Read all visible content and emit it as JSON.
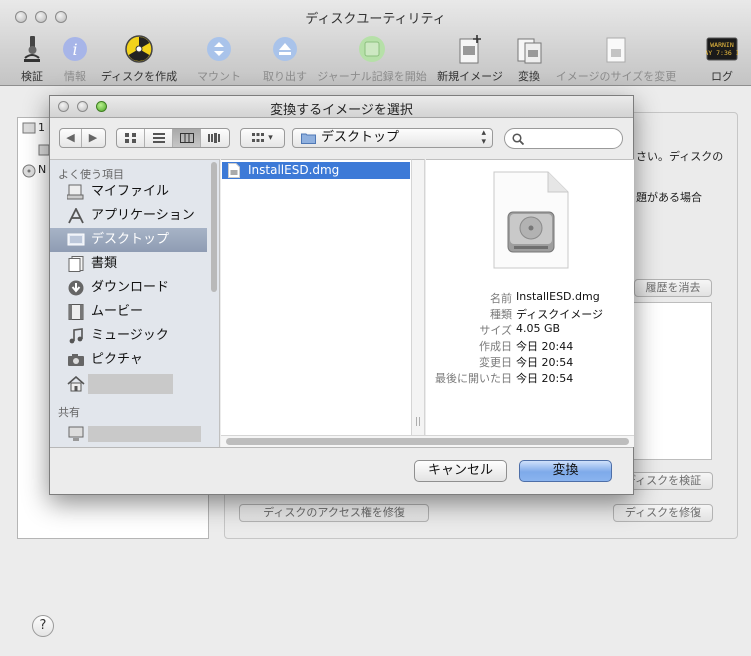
{
  "main": {
    "title": "ディスクユーティリティ",
    "toolbar": [
      {
        "label": "検証",
        "icon": "microscope-icon",
        "enabled": true
      },
      {
        "label": "情報",
        "icon": "info-icon",
        "enabled": false
      },
      {
        "label": "ディスクを作成",
        "icon": "burn-icon",
        "enabled": true
      },
      {
        "label": "マウント",
        "icon": "mount-icon",
        "enabled": false
      },
      {
        "label": "取り出す",
        "icon": "eject-icon",
        "enabled": false
      },
      {
        "label": "ジャーナル記録を開始",
        "icon": "journal-icon",
        "enabled": false
      },
      {
        "label": "新規イメージ",
        "icon": "new-image-icon",
        "enabled": true
      },
      {
        "label": "変換",
        "icon": "convert-icon",
        "enabled": true
      },
      {
        "label": "イメージのサイズを変更",
        "icon": "resize-image-icon",
        "enabled": false
      },
      {
        "label": "ログ",
        "icon": "log-icon",
        "enabled": true
      }
    ],
    "log_icon_text": "WARNIN\nAY 7:36 I",
    "left_list": {
      "item1": "1",
      "item2": "N"
    },
    "right_text_1": "さい。ディスクの",
    "right_text_2": "題がある場合",
    "clear_history_button": "履歴を消去",
    "verify_disk_button": "ディスクを検証",
    "repair_permissions_button": "ディスクのアクセス権を修復",
    "repair_disk_button": "ディスクを修復",
    "help_label": "?"
  },
  "dialog": {
    "title": "変換するイメージを選択",
    "nav": {
      "back": "◀",
      "forward": "▶"
    },
    "view_modes": [
      "icon",
      "list",
      "column",
      "coverflow"
    ],
    "active_view": "column",
    "arrange_label": "▾",
    "location": "デスクトップ",
    "search": {
      "value": "",
      "placeholder": ""
    },
    "sidebar": {
      "favorites_header": "よく使う項目",
      "shared_header": "共有",
      "items": [
        {
          "label": "マイファイル",
          "icon": "all-my-files-icon"
        },
        {
          "label": "アプリケーション",
          "icon": "applications-icon"
        },
        {
          "label": "デスクトップ",
          "icon": "desktop-icon",
          "selected": true
        },
        {
          "label": "書類",
          "icon": "documents-icon"
        },
        {
          "label": "ダウンロード",
          "icon": "downloads-icon"
        },
        {
          "label": "ムービー",
          "icon": "movies-icon"
        },
        {
          "label": "ミュージック",
          "icon": "music-icon"
        },
        {
          "label": "ピクチャ",
          "icon": "pictures-icon"
        }
      ]
    },
    "files": [
      {
        "name": "InstallESD.dmg",
        "selected": true
      }
    ],
    "preview": {
      "rows": [
        {
          "key": "名前",
          "value": "InstallESD.dmg"
        },
        {
          "key": "種類",
          "value": "ディスクイメージ"
        },
        {
          "key": "サイズ",
          "value": "4.05 GB"
        },
        {
          "key": "作成日",
          "value": "今日 20:44"
        },
        {
          "key": "変更日",
          "value": "今日 20:54"
        },
        {
          "key": "最後に開いた日",
          "value": "今日 20:54"
        }
      ]
    },
    "cancel_button": "キャンセル",
    "convert_button": "変換"
  }
}
